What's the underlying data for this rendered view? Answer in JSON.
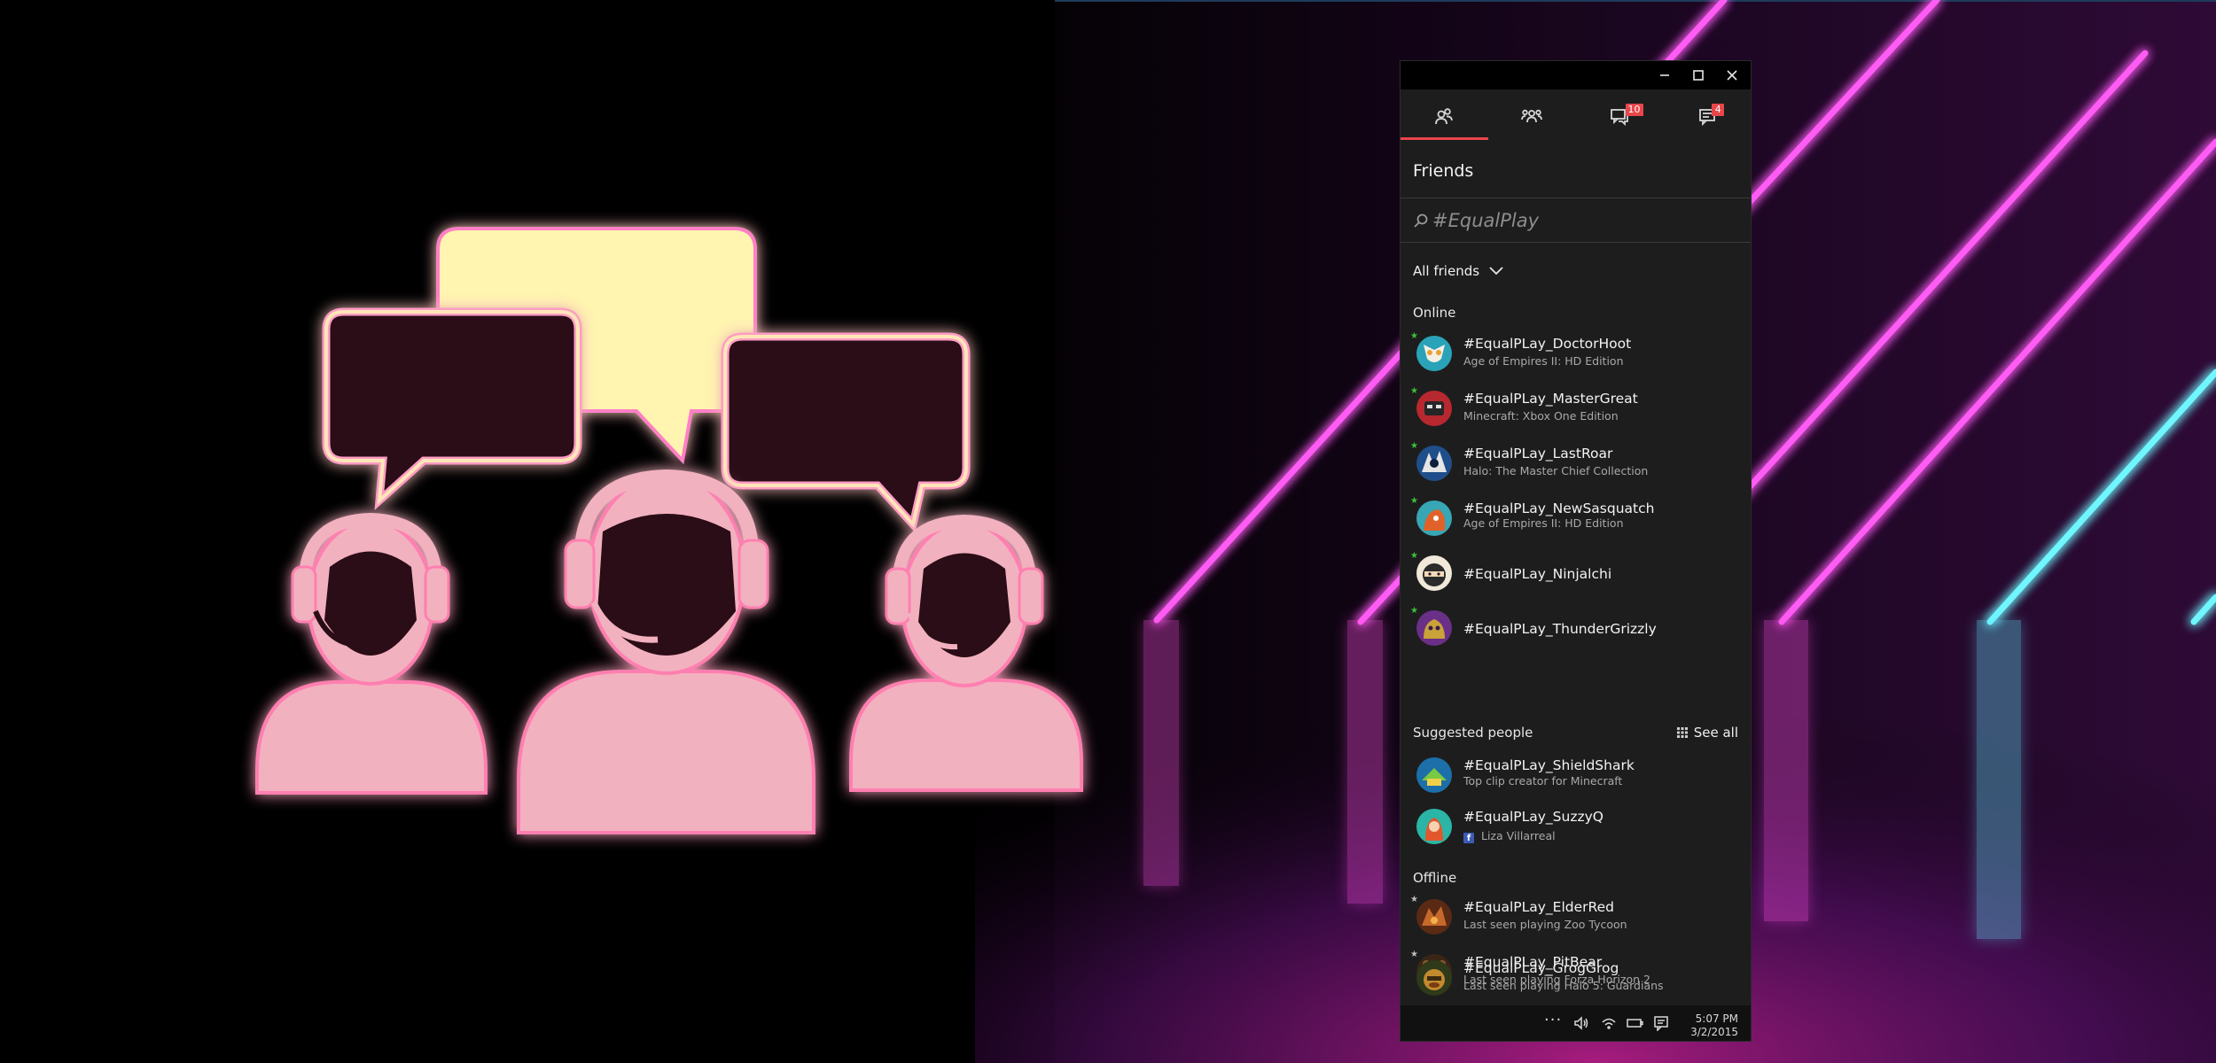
{
  "colors": {
    "accent": "#e8464b",
    "panel_bg": "#1d1d1d",
    "online": "#3cc13b",
    "neon_pink": "#ff3df2",
    "neon_cyan": "#4ff2ff",
    "speech_bubble_fill": "#fff4b0",
    "person_fill": "#f2b1bf"
  },
  "window_controls": {
    "minimize_icon": "minimize-icon",
    "maximize_icon": "maximize-icon",
    "close_icon": "close-icon"
  },
  "tabs": [
    {
      "icon": "friends-icon",
      "badge": ""
    },
    {
      "icon": "party-icon",
      "badge": ""
    },
    {
      "icon": "messages-icon",
      "badge": "10"
    },
    {
      "icon": "notifications-icon",
      "badge": "4"
    }
  ],
  "panel": {
    "title": "Friends",
    "search_placeholder": "#EqualPlay",
    "filter_label": "All friends"
  },
  "sections": {
    "online_label": "Online",
    "suggested_label": "Suggested people",
    "see_all_label": "See all",
    "offline_label": "Offline"
  },
  "online_friends": [
    {
      "gamertag": "#EqualPLay_DoctorHoot",
      "status": "Age of Empires II: HD Edition"
    },
    {
      "gamertag": "#EqualPLay_MasterGreat",
      "status": "Minecraft: Xbox One Edition"
    },
    {
      "gamertag": "#EqualPLay_LastRoar",
      "status": "Halo: The Master Chief Collection"
    },
    {
      "gamertag": "#EqualPLay_NewSasquatch",
      "status": "Age of Empires II: HD Edition"
    },
    {
      "gamertag": "#EqualPLay_Ninjalchi",
      "status": ""
    },
    {
      "gamertag": "#EqualPLay_ThunderGrizzly",
      "status": ""
    }
  ],
  "suggested_people": [
    {
      "gamertag": "#EqualPLay_ShieldShark",
      "status": "Top clip creator for Minecraft"
    },
    {
      "gamertag": "#EqualPLay_SuzzyQ",
      "status": "Liza Villarreal"
    }
  ],
  "offline_friends": [
    {
      "gamertag": "#EqualPLay_ElderRed",
      "status": "Last seen playing Zoo Tycoon"
    },
    {
      "gamertag": "#EqualPLay_PitBear",
      "status": "Last seen playing Forza Horizon 2"
    },
    {
      "gamertag": "#EqualPLay_GrogGrog",
      "status": "Last seen playing Halo 5: Guardians"
    }
  ],
  "taskbar": {
    "more": "···",
    "time": "5:07 PM",
    "date": "3/2/2015"
  }
}
